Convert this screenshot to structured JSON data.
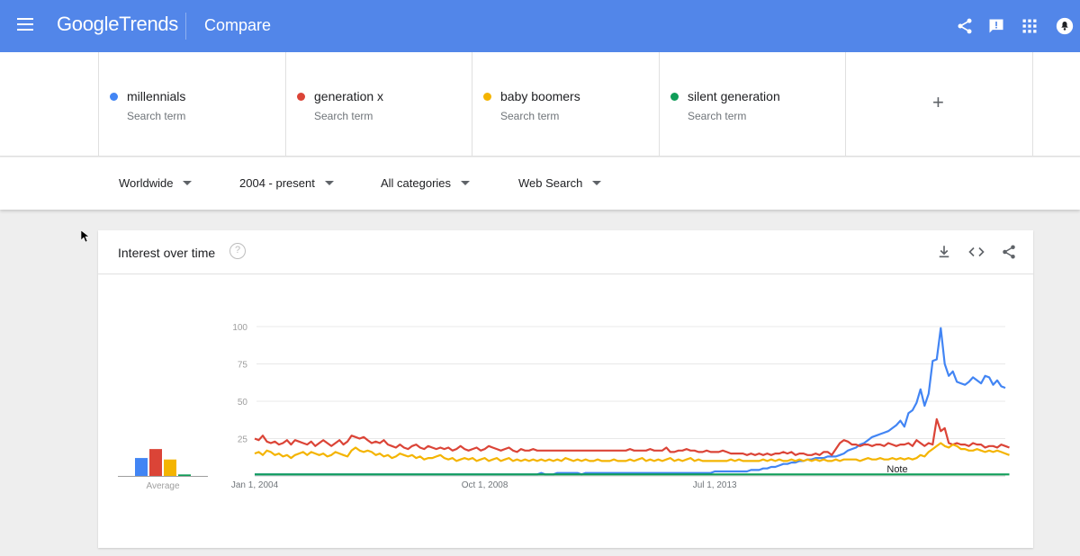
{
  "header": {
    "logo_google": "Google",
    "logo_trends": "Trends",
    "page_name": "Compare"
  },
  "terms": [
    {
      "name": "millennials",
      "sub": "Search term",
      "color": "#4285f4"
    },
    {
      "name": "generation x",
      "sub": "Search term",
      "color": "#db4437"
    },
    {
      "name": "baby boomers",
      "sub": "Search term",
      "color": "#f4b400"
    },
    {
      "name": "silent generation",
      "sub": "Search term",
      "color": "#0f9d58"
    }
  ],
  "add_term": "+",
  "filters": {
    "region": "Worldwide",
    "time": "2004 - present",
    "category": "All categories",
    "property": "Web Search"
  },
  "card": {
    "title": "Interest over time",
    "help": "?"
  },
  "chart_data": {
    "type": "line",
    "ylim": [
      0,
      100
    ],
    "yticks": [
      "100",
      "75",
      "50",
      "25"
    ],
    "xticks": [
      "Jan 1, 2004",
      "Oct 1, 2008",
      "Jul 1, 2013"
    ],
    "x_start": "Jan 1, 2004",
    "x_step": "1 month",
    "average_label": "Average",
    "note_label": "Note",
    "averages": [
      {
        "name": "millennials",
        "value": 12,
        "color": "#4285f4"
      },
      {
        "name": "generation x",
        "value": 18,
        "color": "#db4437"
      },
      {
        "name": "baby boomers",
        "value": 11,
        "color": "#f4b400"
      },
      {
        "name": "silent generation",
        "value": 1,
        "color": "#0f9d58"
      }
    ],
    "series": [
      {
        "name": "millennials",
        "color": "#4285f4",
        "values": [
          1,
          1,
          1,
          1,
          1,
          1,
          1,
          1,
          1,
          1,
          1,
          1,
          1,
          1,
          1,
          1,
          1,
          1,
          1,
          1,
          1,
          1,
          1,
          1,
          1,
          1,
          1,
          1,
          1,
          1,
          1,
          1,
          1,
          1,
          1,
          1,
          1,
          1,
          1,
          1,
          1,
          1,
          1,
          1,
          1,
          1,
          1,
          1,
          1,
          1,
          1,
          1,
          1,
          1,
          1,
          1,
          1,
          1,
          1,
          1,
          1,
          1,
          1,
          1,
          1,
          1,
          1,
          1,
          1,
          1,
          1,
          2,
          1,
          1,
          1,
          2,
          2,
          2,
          2,
          2,
          2,
          1,
          2,
          2,
          2,
          2,
          2,
          2,
          2,
          2,
          2,
          2,
          2,
          2,
          2,
          2,
          2,
          2,
          2,
          2,
          2,
          2,
          2,
          2,
          2,
          2,
          2,
          2,
          2,
          2,
          2,
          2,
          2,
          2,
          3,
          3,
          3,
          3,
          3,
          3,
          3,
          3,
          3,
          4,
          4,
          4,
          5,
          5,
          6,
          6,
          7,
          8,
          8,
          9,
          9,
          10,
          10,
          11,
          11,
          12,
          12,
          12,
          13,
          13,
          13,
          14,
          15,
          17,
          18,
          19,
          21,
          22,
          24,
          26,
          27,
          28,
          29,
          30,
          32,
          34,
          37,
          33,
          42,
          44,
          49,
          58,
          47,
          55,
          77,
          78,
          99,
          75,
          67,
          70,
          63,
          62,
          61,
          63,
          66,
          64,
          62,
          67,
          66,
          61,
          64,
          60,
          59
        ]
      },
      {
        "name": "generation x",
        "color": "#db4437",
        "values": [
          25,
          24,
          27,
          23,
          22,
          23,
          21,
          22,
          24,
          21,
          24,
          23,
          22,
          21,
          23,
          20,
          22,
          24,
          22,
          20,
          22,
          24,
          21,
          23,
          27,
          26,
          25,
          26,
          24,
          22,
          23,
          22,
          24,
          21,
          20,
          19,
          21,
          19,
          18,
          20,
          21,
          19,
          18,
          20,
          19,
          18,
          19,
          18,
          19,
          17,
          18,
          20,
          18,
          17,
          18,
          19,
          17,
          18,
          20,
          19,
          18,
          17,
          18,
          19,
          17,
          16,
          18,
          17,
          17,
          18,
          17,
          17,
          17,
          17,
          17,
          17,
          17,
          17,
          17,
          17,
          17,
          17,
          17,
          17,
          17,
          17,
          17,
          17,
          17,
          17,
          17,
          17,
          17,
          18,
          17,
          17,
          17,
          17,
          18,
          17,
          17,
          17,
          19,
          16,
          16,
          17,
          17,
          18,
          17,
          17,
          16,
          16,
          17,
          16,
          16,
          16,
          17,
          16,
          15,
          15,
          15,
          15,
          14,
          15,
          14,
          15,
          14,
          15,
          14,
          15,
          15,
          16,
          15,
          16,
          14,
          15,
          15,
          14,
          14,
          15,
          14,
          16,
          16,
          14,
          18,
          22,
          24,
          23,
          21,
          21,
          20,
          21,
          21,
          20,
          21,
          21,
          20,
          22,
          21,
          20,
          21,
          21,
          22,
          20,
          24,
          22,
          20,
          22,
          21,
          38,
          30,
          32,
          22,
          21,
          22,
          21,
          21,
          20,
          22,
          21,
          21,
          19,
          20,
          20,
          19,
          21,
          20,
          19
        ]
      },
      {
        "name": "baby boomers",
        "color": "#f4b400",
        "values": [
          15,
          16,
          14,
          17,
          16,
          14,
          15,
          13,
          14,
          12,
          14,
          15,
          16,
          14,
          16,
          15,
          14,
          15,
          13,
          14,
          16,
          15,
          14,
          13,
          17,
          19,
          17,
          16,
          17,
          16,
          14,
          15,
          13,
          14,
          12,
          13,
          15,
          14,
          13,
          14,
          12,
          13,
          11,
          12,
          12,
          13,
          14,
          12,
          11,
          12,
          10,
          11,
          12,
          11,
          12,
          10,
          11,
          12,
          10,
          11,
          12,
          10,
          11,
          12,
          10,
          11,
          10,
          11,
          10,
          11,
          10,
          11,
          10,
          11,
          10,
          11,
          10,
          12,
          11,
          10,
          11,
          10,
          11,
          10,
          10,
          11,
          10,
          10,
          10,
          11,
          10,
          10,
          10,
          11,
          10,
          11,
          12,
          10,
          11,
          10,
          11,
          10,
          11,
          12,
          10,
          11,
          10,
          11,
          12,
          10,
          11,
          10,
          10,
          10,
          10,
          10,
          10,
          10,
          11,
          10,
          11,
          10,
          10,
          10,
          10,
          10,
          11,
          10,
          11,
          10,
          11,
          10,
          10,
          11,
          10,
          11,
          10,
          11,
          10,
          11,
          10,
          11,
          10,
          10,
          11,
          10,
          11,
          11,
          11,
          11,
          10,
          11,
          12,
          11,
          11,
          12,
          11,
          11,
          12,
          11,
          12,
          11,
          12,
          11,
          12,
          14,
          13,
          16,
          18,
          20,
          22,
          20,
          19,
          21,
          20,
          18,
          18,
          17,
          17,
          18,
          17,
          16,
          17,
          16,
          17,
          16,
          15,
          14
        ]
      },
      {
        "name": "silent generation",
        "color": "#0f9d58",
        "values": [
          1,
          1,
          1,
          1,
          1,
          1,
          1,
          1,
          1,
          1,
          1,
          1,
          1,
          1,
          1,
          1,
          1,
          1,
          1,
          1,
          1,
          1,
          1,
          1,
          1,
          1,
          1,
          1,
          1,
          1,
          1,
          1,
          1,
          1,
          1,
          1,
          1,
          1,
          1,
          1,
          1,
          1,
          1,
          1,
          1,
          1,
          1,
          1,
          1,
          1,
          1,
          1,
          1,
          1,
          1,
          1,
          1,
          1,
          1,
          1,
          1,
          1,
          1,
          1,
          1,
          1,
          1,
          1,
          1,
          1,
          1,
          1,
          1,
          1,
          1,
          1,
          1,
          1,
          1,
          1,
          1,
          1,
          1,
          1,
          1,
          1,
          1,
          1,
          1,
          1,
          1,
          1,
          1,
          1,
          1,
          1,
          1,
          1,
          1,
          1,
          1,
          1,
          1,
          1,
          1,
          1,
          1,
          1,
          1,
          1,
          1,
          1,
          1,
          1,
          1,
          1,
          1,
          1,
          1,
          1,
          1,
          1,
          1,
          1,
          1,
          1,
          1,
          1,
          1,
          1,
          1,
          1,
          1,
          1,
          1,
          1,
          1,
          1,
          1,
          1,
          1,
          1,
          1,
          1,
          1,
          1,
          1,
          1,
          1,
          1,
          1,
          1,
          1,
          1,
          1,
          1,
          1,
          1,
          1,
          1,
          1,
          1,
          1,
          1,
          1,
          1,
          1,
          1,
          1,
          1,
          1,
          1,
          1,
          1,
          1,
          1,
          1,
          1,
          1,
          1,
          1,
          1,
          1,
          1,
          1,
          1,
          1,
          1
        ]
      }
    ]
  }
}
